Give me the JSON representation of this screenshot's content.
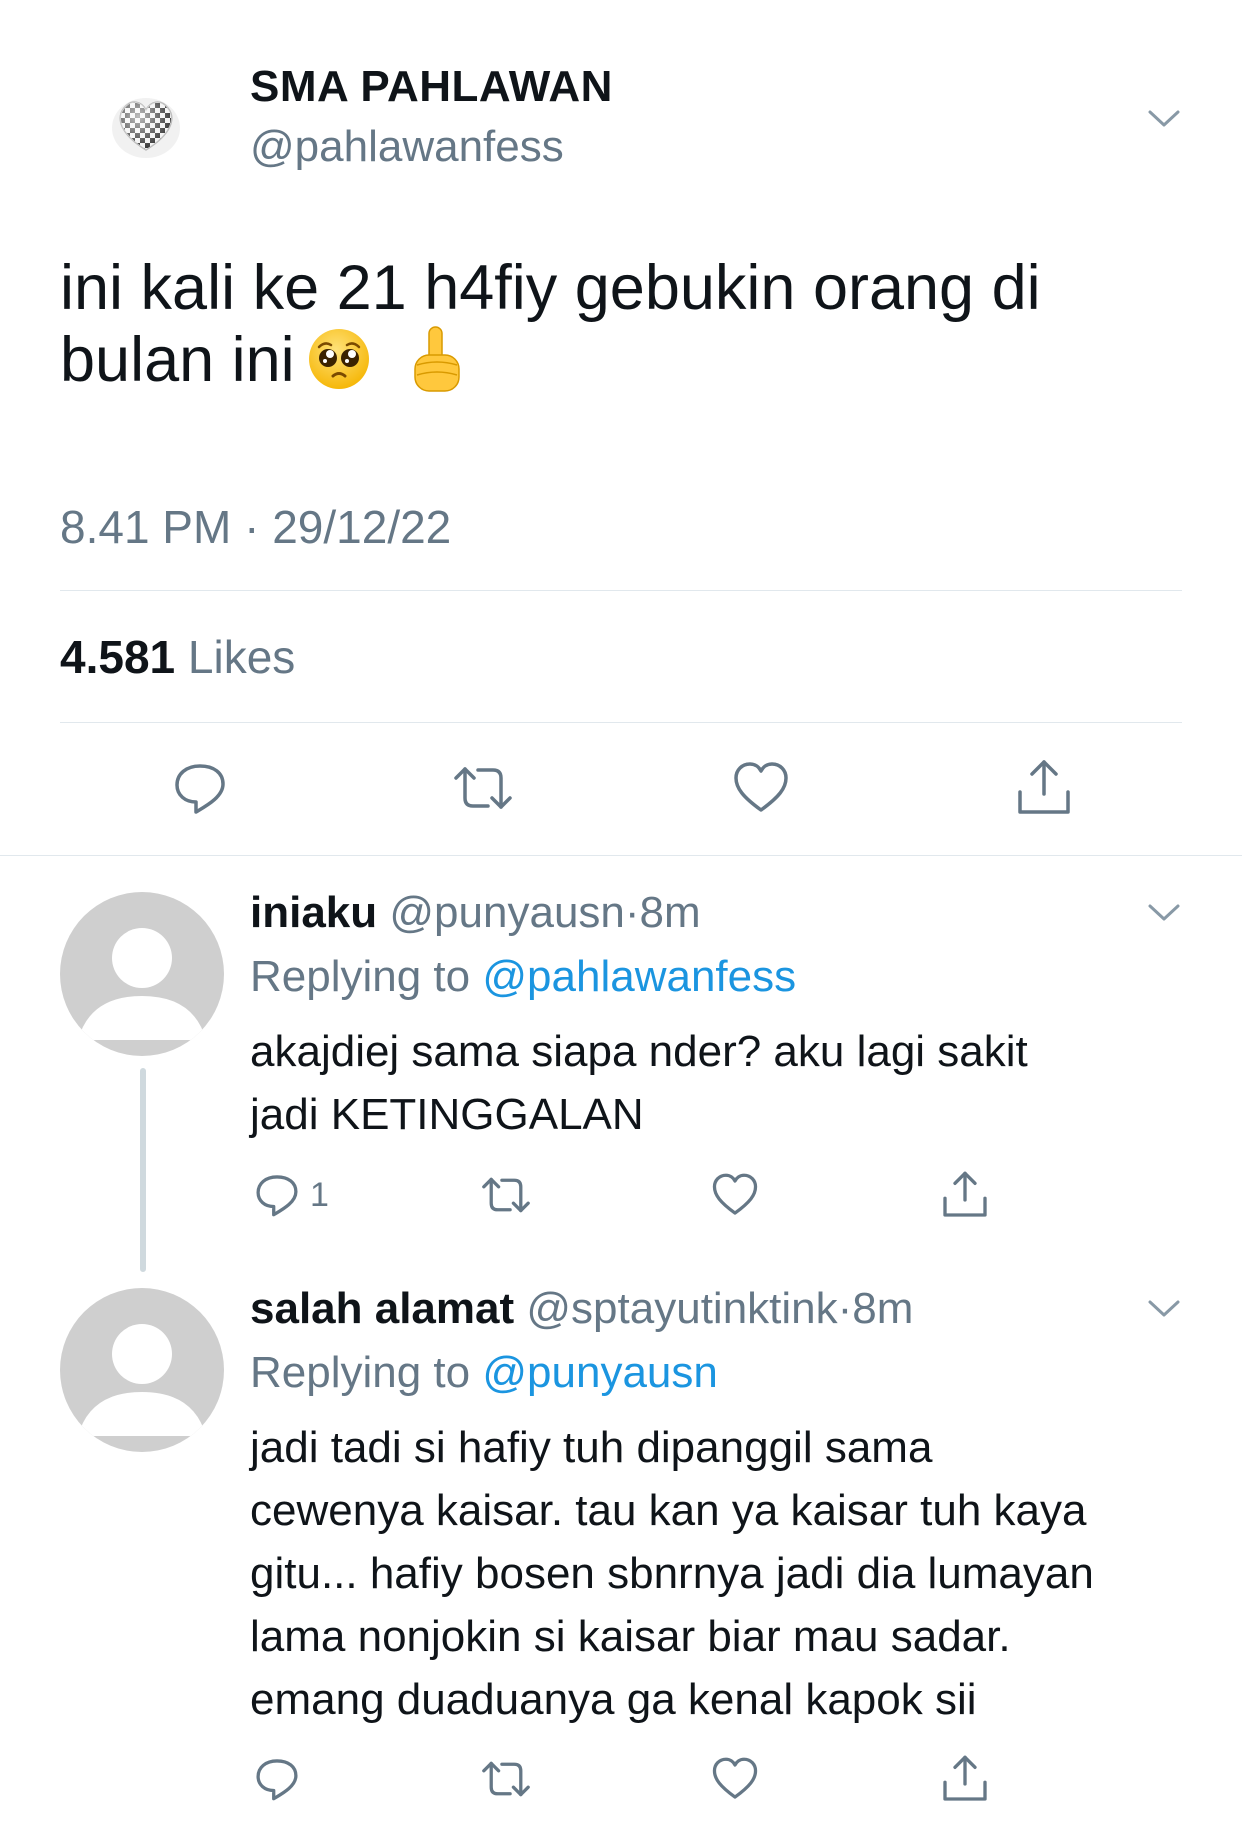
{
  "tweet": {
    "display_name": "SMA PAHLAWAN",
    "handle": "@pahlawanfess",
    "text_line1": "ini kali ke 21 h4fiy gebukin orang di",
    "text_line2": "bulan ini",
    "emojis": [
      "pleading-face-emoji",
      "index-pointing-up-emoji"
    ],
    "time": "8.41 PM",
    "date_sep": "·",
    "date": "29/12/22",
    "likes_count": "4.581",
    "likes_label": "Likes"
  },
  "replies": [
    {
      "name": "iniaku",
      "handle": "@punyausn",
      "dot": "·",
      "time": "8m",
      "replying_label": "Replying to",
      "replying_to": "@pahlawanfess",
      "lines": [
        "akajdiej sama siapa nder? aku lagi sakit",
        "jadi KETINGGALAN"
      ],
      "reply_count": "1"
    },
    {
      "name": "salah alamat",
      "handle": "@sptayutinktink",
      "dot": "·",
      "time": "8m",
      "replying_label": "Replying to",
      "replying_to": "@punyausn",
      "lines": [
        "jadi tadi si hafiy tuh dipanggil sama",
        "cewenya kaisar. tau kan ya kaisar tuh kaya",
        "gitu... hafiy bosen sbnrnya jadi dia lumayan",
        "lama nonjokin si kaisar biar mau sadar.",
        "emang duaduanya ga kenal kapok sii"
      ]
    }
  ],
  "colors": {
    "text": "#0f1419",
    "secondary": "#657786",
    "link": "#1b95e0",
    "divider": "#e1e8ed",
    "avatar_bg": "#cfcfcf"
  }
}
